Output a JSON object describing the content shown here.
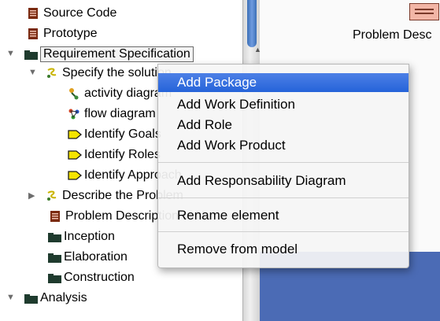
{
  "tree": {
    "items": [
      {
        "label": "Source Code",
        "icon": "document-icon",
        "twisty": "none"
      },
      {
        "label": "Prototype",
        "icon": "document-icon",
        "twisty": "none"
      },
      {
        "label": "Requirement Specification",
        "icon": "folder-icon",
        "twisty": "down",
        "selected": true
      },
      {
        "label": "Specify the solution",
        "icon": "use-case-icon",
        "twisty": "down"
      },
      {
        "label": "activity diagram",
        "icon": "activity-diagram-icon",
        "twisty": "none"
      },
      {
        "label": "flow diagram",
        "icon": "flow-diagram-icon",
        "twisty": "none"
      },
      {
        "label": "Identify Goals",
        "icon": "task-arrow-icon",
        "twisty": "none"
      },
      {
        "label": "Identify Roles",
        "icon": "task-arrow-icon",
        "twisty": "none"
      },
      {
        "label": "Identify Approach",
        "icon": "task-arrow-icon",
        "twisty": "none"
      },
      {
        "label": "Describe the Problem",
        "icon": "use-case-icon",
        "twisty": "right"
      },
      {
        "label": "Problem Description in N",
        "icon": "document-icon",
        "twisty": "none"
      },
      {
        "label": "Inception",
        "icon": "folder-icon",
        "twisty": "none"
      },
      {
        "label": "Elaboration",
        "icon": "folder-icon",
        "twisty": "none"
      },
      {
        "label": "Construction",
        "icon": "folder-icon",
        "twisty": "none"
      },
      {
        "label": "Analysis",
        "icon": "folder-icon",
        "twisty": "down"
      }
    ]
  },
  "right_panel": {
    "problem_label": "Problem Desc"
  },
  "context_menu": {
    "items": [
      {
        "label": "Add Package",
        "highlighted": true
      },
      {
        "label": "Add Work Definition"
      },
      {
        "label": "Add Role"
      },
      {
        "label": "Add Work Product"
      },
      {
        "label": "Add Responsability Diagram"
      },
      {
        "label": "Rename element"
      },
      {
        "label": "Remove from model"
      }
    ]
  },
  "colors": {
    "selection": "#2563d9",
    "folder": "#1f3b2e",
    "document": "#7a2a10",
    "task_arrow": "#f5e400",
    "editor_blue": "#4b6bb5"
  }
}
